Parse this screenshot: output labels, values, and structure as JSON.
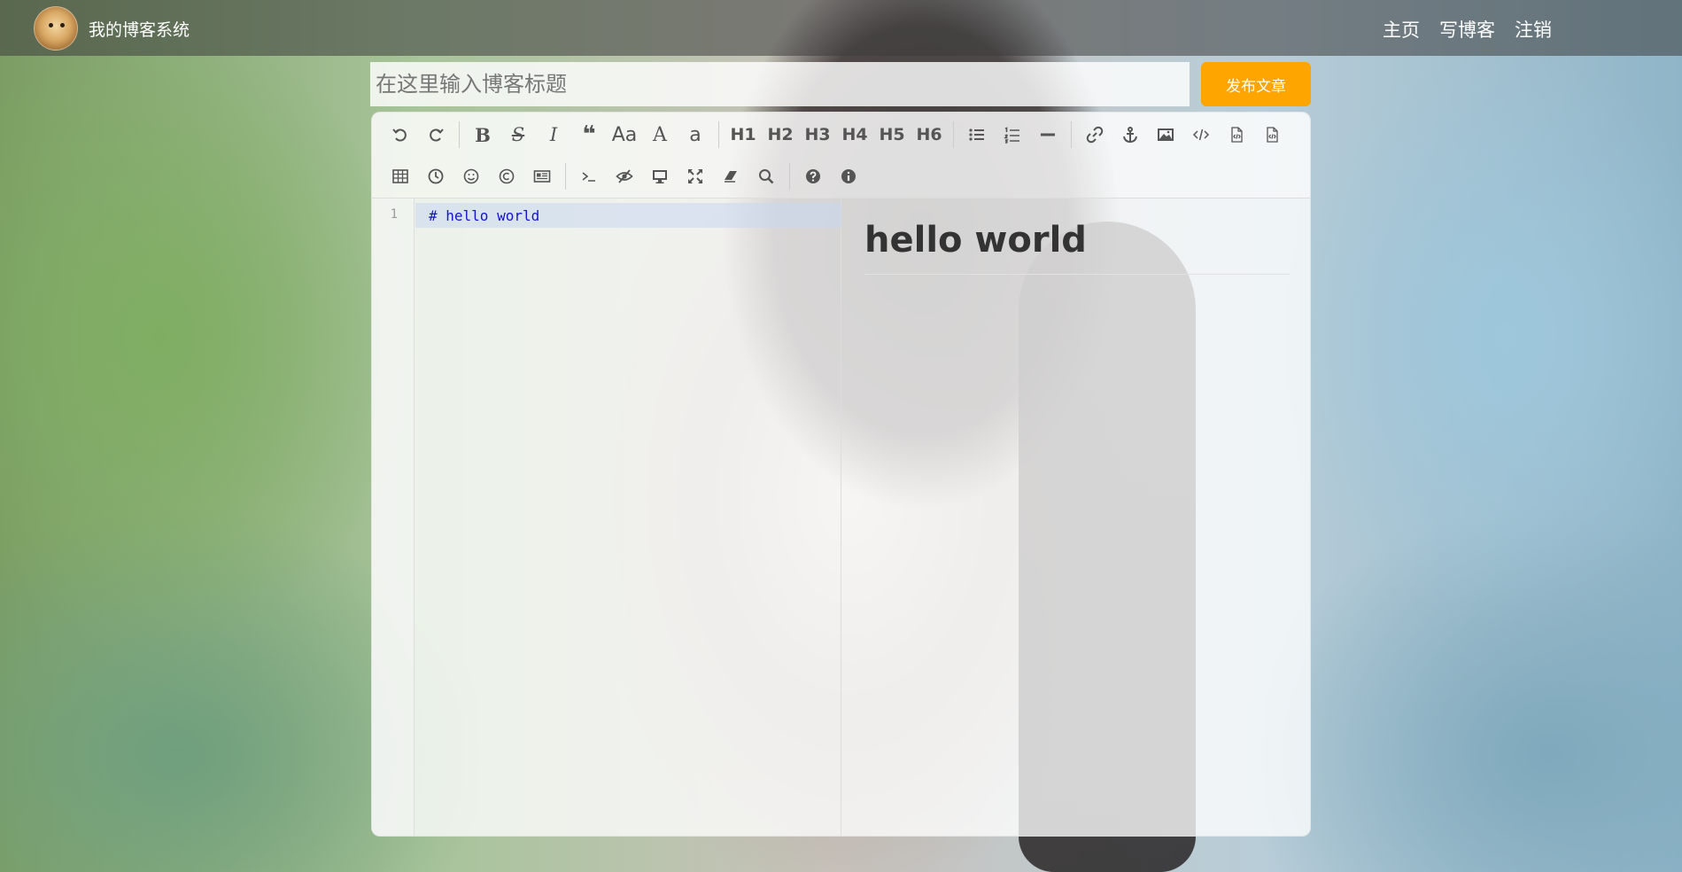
{
  "navbar": {
    "site_title": "我的博客系统",
    "links": [
      "主页",
      "写博客",
      "注销"
    ]
  },
  "editor_header": {
    "title_placeholder": "在这里输入博客标题",
    "publish_label": "发布文章"
  },
  "toolbar": {
    "headings": [
      "H1",
      "H2",
      "H3",
      "H4",
      "H5",
      "H6"
    ],
    "text_glyphs": {
      "bold": "B",
      "strikethrough": "S",
      "italic": "I",
      "quote": "❝",
      "uppercase": "Aa",
      "uppercase_first": "A",
      "lowercase": "a"
    },
    "icons_row1": [
      "undo-icon",
      "redo-icon",
      "bold-icon",
      "strikethrough-icon",
      "italic-icon",
      "quote-icon",
      "uppercase-icon",
      "capitalize-icon",
      "lowercase-icon",
      "h1",
      "h2",
      "h3",
      "h4",
      "h5",
      "h6",
      "unordered-list-icon",
      "ordered-list-icon",
      "horizontal-rule-icon",
      "link-icon",
      "anchor-icon",
      "image-icon",
      "code-icon",
      "code-block-icon",
      "file-code-icon"
    ],
    "icons_row2": [
      "table-icon",
      "datetime-icon",
      "emoji-icon",
      "html-entities-icon",
      "pagebreak-icon",
      "terminal-icon",
      "hide-preview-icon",
      "fullscreen-preview-icon",
      "fullscreen-icon",
      "clear-icon",
      "search-icon",
      "help-icon",
      "info-icon"
    ]
  },
  "code": {
    "line_numbers": [
      "1"
    ],
    "lines": [
      "# hello world"
    ]
  },
  "preview": {
    "heading": "hello world"
  },
  "colors": {
    "publish_button": "#ffa500",
    "markdown_heading_code": "#1515c8",
    "navbar_bg": "rgba(60,60,60,0.55)"
  }
}
